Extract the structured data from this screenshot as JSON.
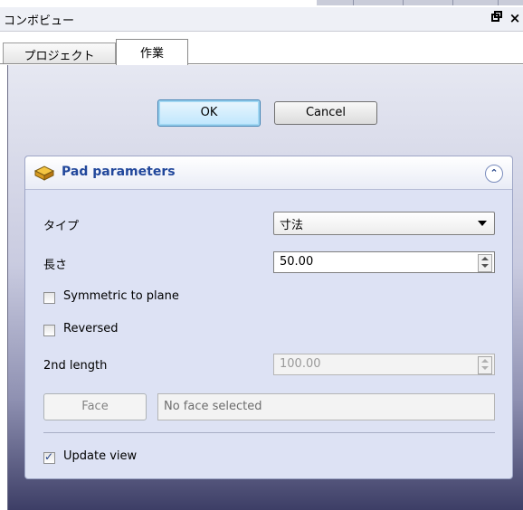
{
  "window": {
    "title": "コンボビュー",
    "float_icon": "restore-icon",
    "close_glyph": "×"
  },
  "tabs": [
    {
      "label": "プロジェクト",
      "active": false
    },
    {
      "label": "作業",
      "active": true
    }
  ],
  "dialog": {
    "ok_label": "OK",
    "cancel_label": "Cancel"
  },
  "taskbox": {
    "title": "Pad parameters",
    "icon": "pad-icon",
    "collapse_icon": "collapse-up-icon",
    "type_label": "タイプ",
    "type_value": "寸法",
    "length_label": "長さ",
    "length_value": "50.00",
    "symmetric_label": "Symmetric to plane",
    "symmetric_checked": false,
    "reversed_label": "Reversed",
    "reversed_checked": false,
    "second_length_label": "2nd length",
    "second_length_value": "100.00",
    "face_button_label": "Face",
    "face_value": "No face selected",
    "update_view_label": "Update view",
    "update_view_checked": true
  },
  "colors": {
    "accent": "#21479b",
    "panel_top": "#e6e8f2",
    "panel_bottom": "#3d3e66"
  }
}
